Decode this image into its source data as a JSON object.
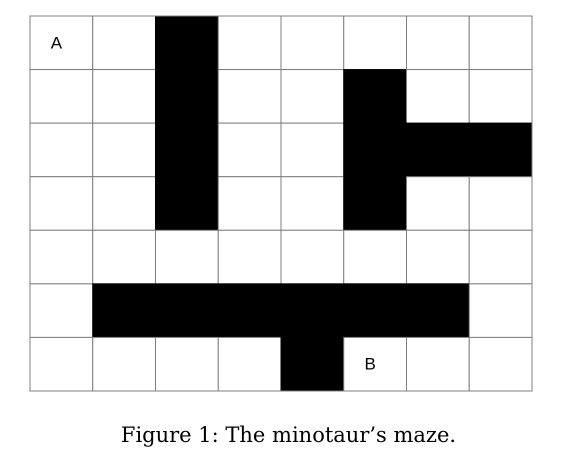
{
  "maze": {
    "rows": 7,
    "cols": 8,
    "grid": [
      [
        0,
        0,
        1,
        0,
        0,
        0,
        0,
        0
      ],
      [
        0,
        0,
        1,
        0,
        0,
        1,
        0,
        0
      ],
      [
        0,
        0,
        1,
        0,
        0,
        1,
        1,
        1
      ],
      [
        0,
        0,
        1,
        0,
        0,
        1,
        0,
        0
      ],
      [
        0,
        0,
        0,
        0,
        0,
        0,
        0,
        0
      ],
      [
        0,
        1,
        1,
        1,
        1,
        1,
        1,
        0
      ],
      [
        0,
        0,
        0,
        0,
        1,
        0,
        0,
        0
      ]
    ],
    "labels": [
      {
        "text": "A",
        "row": 0,
        "col": 0
      },
      {
        "text": "B",
        "row": 6,
        "col": 5
      }
    ],
    "wall_color": "#000000",
    "open_color": "#ffffff",
    "grid_line_color": "#7f7f7f"
  },
  "caption": {
    "text": "Figure 1: The minotaur’s maze."
  }
}
